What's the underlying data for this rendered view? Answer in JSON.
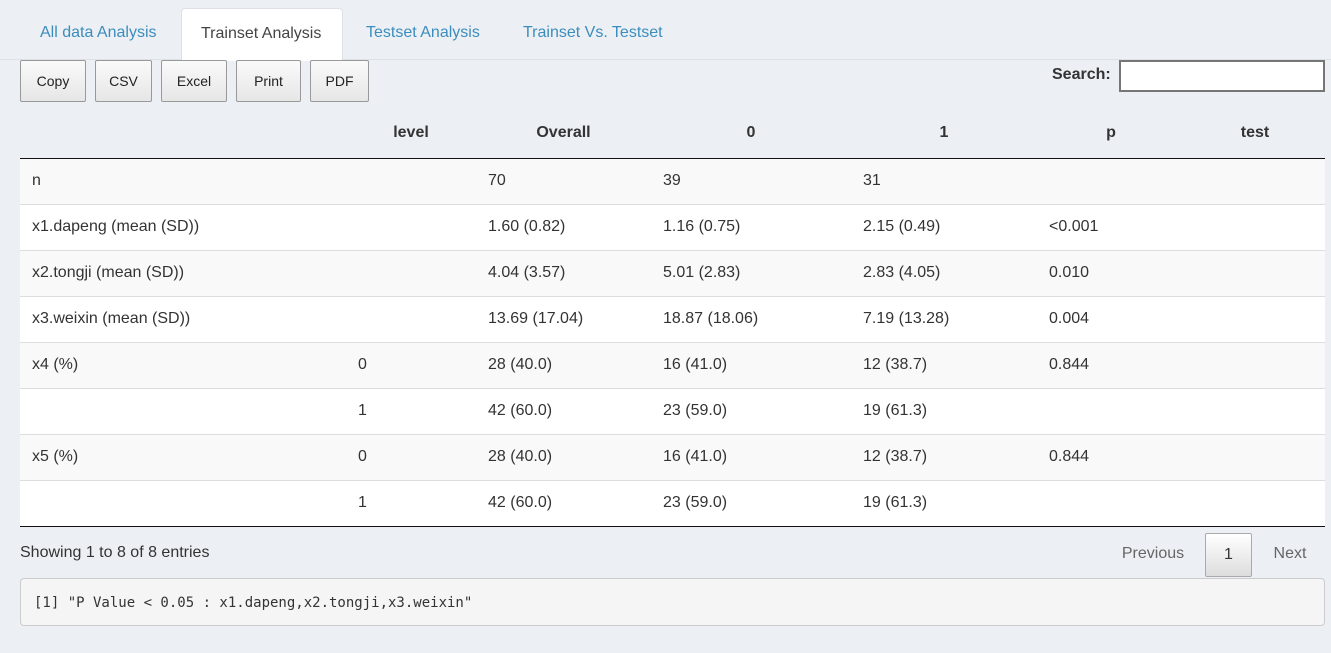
{
  "tabs": [
    {
      "label": "All data Analysis",
      "active": false
    },
    {
      "label": "Trainset Analysis",
      "active": true
    },
    {
      "label": "Testset Analysis",
      "active": false
    },
    {
      "label": "Trainset Vs. Testset",
      "active": false
    }
  ],
  "toolbar": {
    "copy_label": "Copy",
    "csv_label": "CSV",
    "excel_label": "Excel",
    "print_label": "Print",
    "pdf_label": "PDF"
  },
  "search": {
    "label": "Search:",
    "value": ""
  },
  "table": {
    "columns": [
      "",
      "level",
      "Overall",
      "0",
      "1",
      "p",
      "test"
    ],
    "rows": [
      [
        "n",
        "",
        "70",
        "39",
        "31",
        "",
        ""
      ],
      [
        "x1.dapeng (mean (SD))",
        "",
        "1.60 (0.82)",
        "1.16 (0.75)",
        "2.15 (0.49)",
        "<0.001",
        ""
      ],
      [
        "x2.tongji (mean (SD))",
        "",
        "4.04 (3.57)",
        "5.01 (2.83)",
        "2.83 (4.05)",
        "0.010",
        ""
      ],
      [
        "x3.weixin (mean (SD))",
        "",
        "13.69 (17.04)",
        "18.87 (18.06)",
        "7.19 (13.28)",
        "0.004",
        ""
      ],
      [
        "x4 (%)",
        "0",
        "28 (40.0)",
        "16 (41.0)",
        "12 (38.7)",
        "0.844",
        ""
      ],
      [
        "",
        "1",
        "42 (60.0)",
        "23 (59.0)",
        "19 (61.3)",
        "",
        ""
      ],
      [
        "x5 (%)",
        "0",
        "28 (40.0)",
        "16 (41.0)",
        "12 (38.7)",
        "0.844",
        ""
      ],
      [
        "",
        "1",
        "42 (60.0)",
        "23 (59.0)",
        "19 (61.3)",
        "",
        ""
      ]
    ]
  },
  "info": "Showing 1 to 8 of 8 entries",
  "pagination": {
    "previous": "Previous",
    "current": "1",
    "next": "Next"
  },
  "console_output": "[1] \"P Value < 0.05 : x1.dapeng,x2.tongji,x3.weixin\""
}
